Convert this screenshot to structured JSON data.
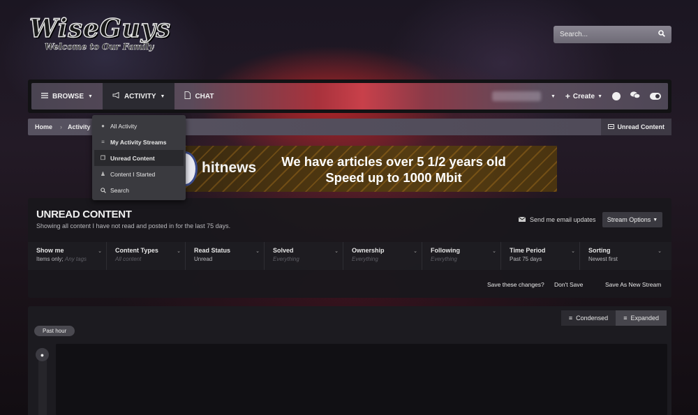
{
  "logo": {
    "title": "WiseGuys",
    "tagline": "Welcome to Our Family"
  },
  "search": {
    "placeholder": "Search..."
  },
  "nav": {
    "items": [
      {
        "label": "Browse",
        "icon": "list-icon"
      },
      {
        "label": "Activity",
        "icon": "megaphone-icon"
      },
      {
        "label": "Chat",
        "icon": "chat-page-icon"
      }
    ],
    "create_label": "Create"
  },
  "activity_menu": {
    "items": [
      {
        "label": "All Activity",
        "icon": "globe-icon"
      },
      {
        "label": "My Activity Streams",
        "icon": "list-icon"
      },
      {
        "label": "Unread Content",
        "icon": "copy-icon"
      },
      {
        "label": "Content I Started",
        "icon": "user-plus-icon"
      },
      {
        "label": "Search",
        "icon": "search-icon"
      }
    ]
  },
  "breadcrumb": {
    "items": [
      "Home",
      "Activity"
    ],
    "right_link": "Unread Content"
  },
  "ad": {
    "brand": "hitnews",
    "line1": "We have articles over 5 1/2 years old",
    "line2": "Speed up to 1000 Mbit"
  },
  "stream": {
    "title": "UNREAD CONTENT",
    "description": "Showing all content I have not read and posted in for the last 75 days.",
    "email_updates": "Send me email updates",
    "options_label": "Stream Options",
    "filters": [
      {
        "label": "Show me",
        "value": "Items only;",
        "value_muted": "Any tags"
      },
      {
        "label": "Content Types",
        "value": "",
        "value_muted": "All content"
      },
      {
        "label": "Read Status",
        "value": "Unread",
        "value_muted": ""
      },
      {
        "label": "Solved",
        "value": "",
        "value_muted": "Everything"
      },
      {
        "label": "Ownership",
        "value": "",
        "value_muted": "Everything"
      },
      {
        "label": "Following",
        "value": "",
        "value_muted": "Everything"
      },
      {
        "label": "Time Period",
        "value": "Past 75 days",
        "value_muted": ""
      },
      {
        "label": "Sorting",
        "value": "Newest first",
        "value_muted": ""
      }
    ],
    "save_prompt": "Save these changes?",
    "dont_save": "Don't Save",
    "save_new": "Save As New Stream"
  },
  "results": {
    "views": {
      "condensed": "Condensed",
      "expanded": "Expanded"
    },
    "time_group": "Past hour"
  }
}
